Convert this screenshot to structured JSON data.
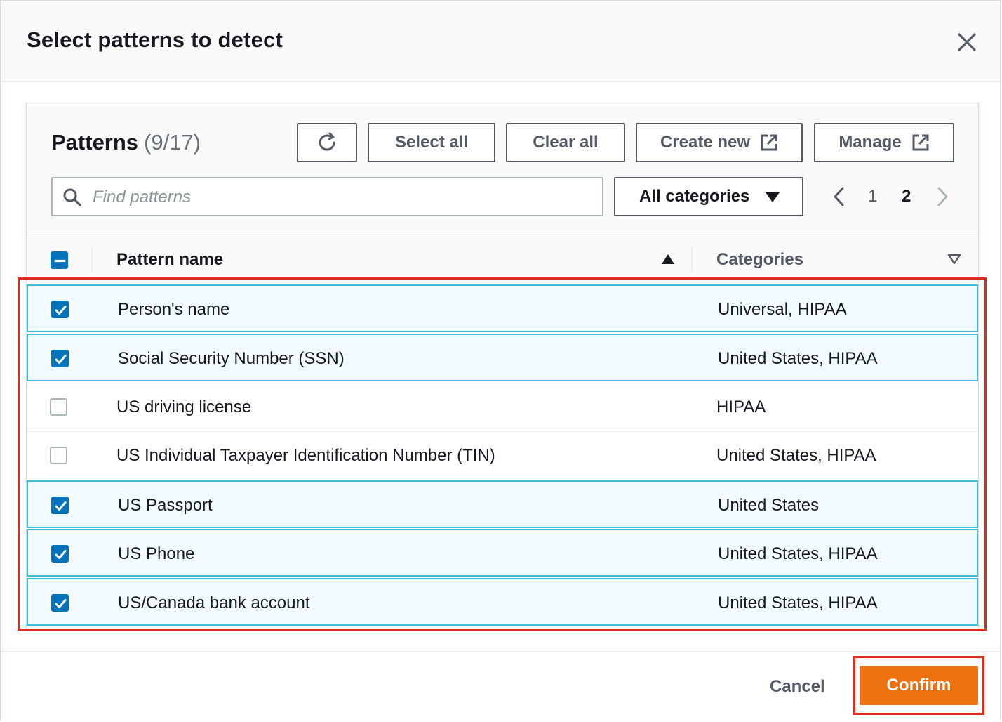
{
  "modal": {
    "title": "Select patterns to detect"
  },
  "panel": {
    "heading": "Patterns",
    "count": "(9/17)",
    "buttons": {
      "select_all": "Select all",
      "clear_all": "Clear all",
      "create_new": "Create new",
      "manage": "Manage"
    },
    "search": {
      "placeholder": "Find patterns",
      "value": ""
    },
    "category_filter": "All categories",
    "pagination": {
      "pages": [
        "1",
        "2"
      ],
      "current": "2"
    }
  },
  "table": {
    "columns": {
      "name": "Pattern name",
      "categories": "Categories"
    },
    "rows": [
      {
        "name": "Person's name",
        "categories": "Universal, HIPAA",
        "checked": true
      },
      {
        "name": "Social Security Number (SSN)",
        "categories": "United States, HIPAA",
        "checked": true
      },
      {
        "name": "US driving license",
        "categories": "HIPAA",
        "checked": false
      },
      {
        "name": "US Individual Taxpayer Identification Number (TIN)",
        "categories": "United States, HIPAA",
        "checked": false
      },
      {
        "name": "US Passport",
        "categories": "United States",
        "checked": true
      },
      {
        "name": "US Phone",
        "categories": "United States, HIPAA",
        "checked": true
      },
      {
        "name": "US/Canada bank account",
        "categories": "United States, HIPAA",
        "checked": true
      }
    ]
  },
  "footer": {
    "cancel": "Cancel",
    "confirm": "Confirm"
  },
  "colors": {
    "accent": "#0073bb",
    "primary_button": "#ec7211",
    "selected_row_bg": "#f1faff",
    "selected_row_border": "#44b9d6",
    "highlight_outline": "#e02d1b"
  }
}
